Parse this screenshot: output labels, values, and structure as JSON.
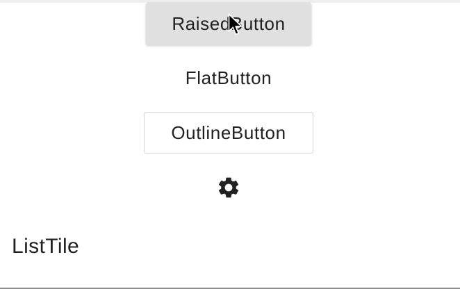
{
  "buttons": {
    "raised_label": "RaisedButton",
    "flat_label": "FlatButton",
    "outline_label": "OutlineButton"
  },
  "icon_button": {
    "icon": "gear-icon",
    "color": "#212121"
  },
  "list_tile": {
    "title": "ListTile"
  },
  "colors": {
    "raised_background": "#e0e0e0",
    "outline_border": "#d4d4d4",
    "text": "#212121"
  }
}
